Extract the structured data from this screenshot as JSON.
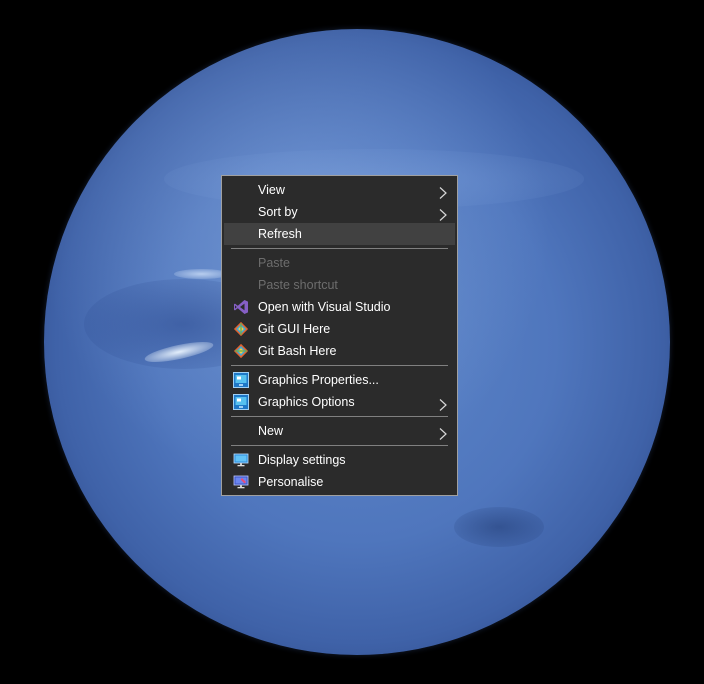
{
  "menu": {
    "items": [
      {
        "label": "View",
        "icon": "",
        "submenu": true,
        "disabled": false,
        "hover": false
      },
      {
        "label": "Sort by",
        "icon": "",
        "submenu": true,
        "disabled": false,
        "hover": false
      },
      {
        "label": "Refresh",
        "icon": "",
        "submenu": false,
        "disabled": false,
        "hover": true
      },
      {
        "separator": true
      },
      {
        "label": "Paste",
        "icon": "",
        "submenu": false,
        "disabled": true,
        "hover": false
      },
      {
        "label": "Paste shortcut",
        "icon": "",
        "submenu": false,
        "disabled": true,
        "hover": false
      },
      {
        "label": "Open with Visual Studio",
        "icon": "visual-studio-icon",
        "submenu": false,
        "disabled": false,
        "hover": false
      },
      {
        "label": "Git GUI Here",
        "icon": "git-gui-icon",
        "submenu": false,
        "disabled": false,
        "hover": false
      },
      {
        "label": "Git Bash Here",
        "icon": "git-bash-icon",
        "submenu": false,
        "disabled": false,
        "hover": false
      },
      {
        "separator": true
      },
      {
        "label": "Graphics Properties...",
        "icon": "graphics-properties-icon",
        "submenu": false,
        "disabled": false,
        "hover": false
      },
      {
        "label": "Graphics Options",
        "icon": "graphics-options-icon",
        "submenu": true,
        "disabled": false,
        "hover": false
      },
      {
        "separator": true
      },
      {
        "label": "New",
        "icon": "",
        "submenu": true,
        "disabled": false,
        "hover": false
      },
      {
        "separator": true
      },
      {
        "label": "Display settings",
        "icon": "display-settings-icon",
        "submenu": false,
        "disabled": false,
        "hover": false
      },
      {
        "label": "Personalise",
        "icon": "personalise-icon",
        "submenu": false,
        "disabled": false,
        "hover": false
      }
    ]
  },
  "colors": {
    "menu_background": "#2b2b2b",
    "menu_hover": "#414141",
    "menu_text": "#ffffff",
    "menu_disabled_text": "#6d6d6d",
    "wallpaper_planet": "#4f76bd"
  }
}
